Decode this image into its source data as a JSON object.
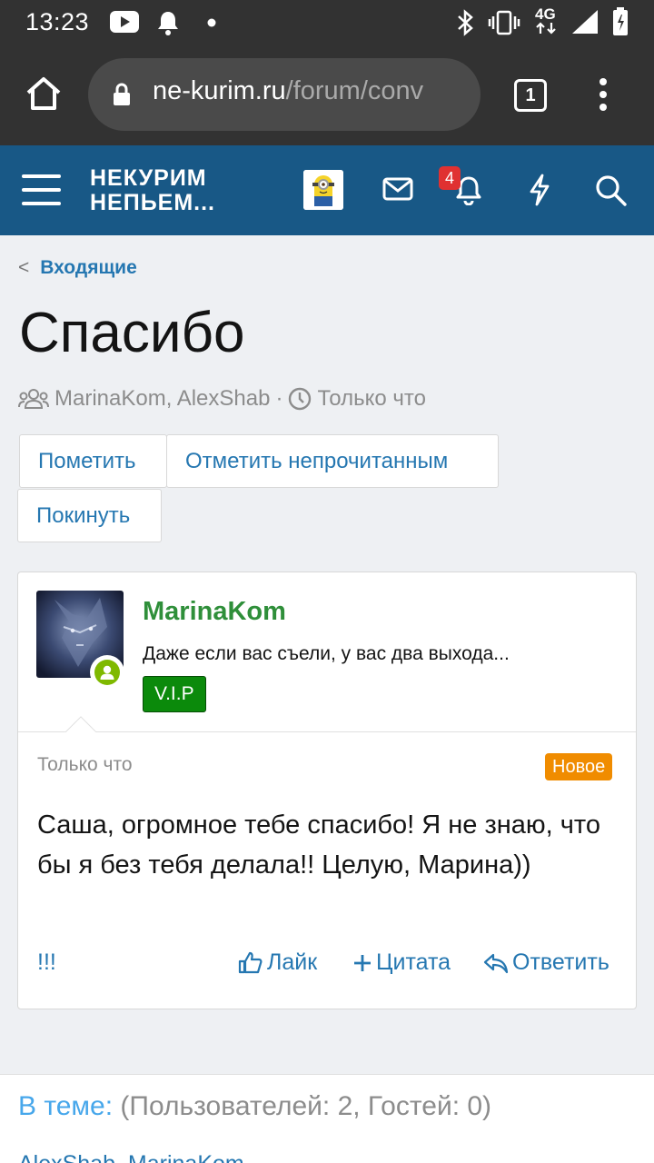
{
  "status_bar": {
    "time": "13:23",
    "network": "4G",
    "icons": [
      "youtube-icon",
      "notification-bell-icon",
      "dot-icon",
      "bluetooth-icon",
      "vibrate-icon",
      "signal-icon",
      "battery-icon"
    ]
  },
  "browser": {
    "url_domain": "ne-kurim.ru",
    "url_path": "/forum/conv",
    "tab_count": "1"
  },
  "site_header": {
    "logo_line1": "НЕКУРИМ",
    "logo_line2": "НЕПЬЕМ...",
    "alerts_count": "4",
    "colors": {
      "header_bg": "#185886",
      "link": "#2577b1"
    }
  },
  "breadcrumb": {
    "label": "Входящие"
  },
  "page": {
    "title": "Спасибо",
    "participants": "MarinaKom, AlexShab",
    "separator": "·",
    "time": "Только что"
  },
  "buttons": {
    "mark": "Пометить",
    "mark_unread": "Отметить непрочитанным",
    "leave": "Покинуть"
  },
  "message": {
    "username": "MarinaKom",
    "user_title": "Даже если вас съели, у вас два выхода...",
    "banner": "V.I.P",
    "time": "Только что",
    "new_label": "Новое",
    "body": "Саша, огромное тебе спасибо! Я не знаю, что бы я без тебя делала!! Целую, Марина))",
    "report": "!!!",
    "like": "Лайк",
    "quote": "Цитата",
    "reply": "Ответить"
  },
  "online": {
    "label": "В теме:",
    "stats": "(Пользователей: 2, Гостей: 0)",
    "users": "AlexShab, MarinaKom"
  }
}
